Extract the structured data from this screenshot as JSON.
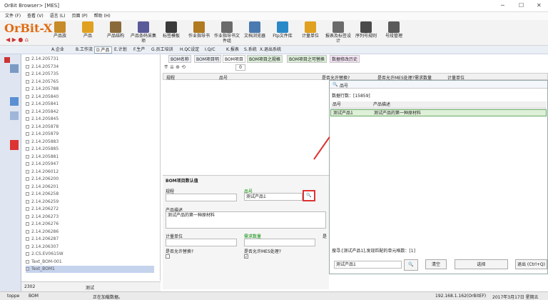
{
  "window": {
    "title": "OrBit Browser> [MES]"
  },
  "menu": [
    "文件 (F)",
    "查看 (V)",
    "语言 (L)",
    "页面 (P)",
    "帮助 (H)"
  ],
  "logo": "OrBit-X",
  "toolbar": [
    "产品族",
    "产品",
    "产品结构",
    "产品条码采集项",
    "标签模板",
    "作业指导书",
    "作业指导书文件组",
    "文档浏览器",
    "Ftp文件库",
    "计量单位",
    "报表及标签设计",
    "序列号规则",
    "号段管理"
  ],
  "nav_tabs": [
    "A.企业",
    "B.工作流",
    "D.产品",
    "E.计划",
    "F.生产",
    "G.员工培训",
    "H.QC设定",
    "I.Q/C",
    "K.报表",
    "S.系统",
    "X.退出系统"
  ],
  "tree_items": [
    "2.14.205731",
    "2.14.205734",
    "2.14.205735",
    "2.14.205765",
    "2.14.205788",
    "2.14.205840",
    "2.14.205841",
    "2.14.205842",
    "2.14.205845",
    "2.14.205878",
    "2.14.205879",
    "2.14.205883",
    "2.14.205885",
    "2.14.205881",
    "2.14.205947",
    "2.14.206012",
    "2.14.206200",
    "2.14.206201",
    "2.14.206258",
    "2.14.206259",
    "2.14.206272",
    "2.14.206273",
    "2.14.206276",
    "2.14.206286",
    "2.14.206287",
    "2.14.206307",
    "2.CS.EV0615W",
    "Text_BOM-001",
    "Text_BOM1"
  ],
  "tree_footer": {
    "count": "2302",
    "label": "测试"
  },
  "right_tabs": [
    "BOM名称",
    "BOM项目明",
    "BOM项目",
    "BOM项目之规格",
    "BOM项目之可替换",
    "数据修改历史"
  ],
  "grid_headers": [
    "规程",
    "品号",
    "是否允许替换?",
    "是否允许MES处理?",
    "需求数量",
    "计量单位"
  ],
  "grid_page": "0",
  "popup": {
    "search_label": "品号",
    "rows_label": "数据行数：[15859]",
    "col_code": "品号",
    "col_desc": "产品描述",
    "row_code": "测试产品1",
    "row_desc": "测试产品的第一种原材料",
    "result_text": "搜寻:[测试产品1],发现匹配的单元格数：[1]",
    "search_value": "测试产品1",
    "btn_clear": "清空",
    "btn_select": "选择",
    "btn_exit": "退出 (Ctrl+Q)"
  },
  "detail": {
    "title": "BOM项目数认值",
    "lbl_spec": "规程",
    "lbl_code": "品号",
    "code_value": "测试产品1",
    "lbl_desc": "产品描述",
    "desc_value": "测试产品的第一种原材料",
    "lbl_unit": "计量单位",
    "lbl_qty": "需求数量",
    "lbl_replace": "是否允许替换?",
    "lbl_mes": "是否允许MES处理?",
    "lbl_s": "是"
  },
  "status": {
    "user": "toppe",
    "module": "BOM",
    "msg": "正在加载数据。",
    "ip": "192.168.1.162(OrBitEF)",
    "date": "2017年3月17日 星期五"
  },
  "colors": {
    "accent": "#e06a10",
    "highlight": "#d33",
    "selected": "#dff0d8"
  }
}
